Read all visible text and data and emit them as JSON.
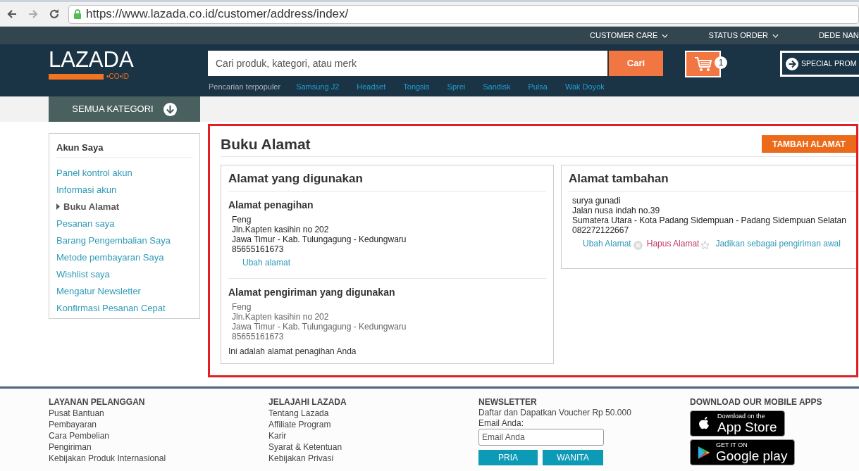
{
  "browser": {
    "url": "https://www.lazada.co.id/customer/address/index/"
  },
  "top_links": [
    {
      "label": "CUSTOMER CARE",
      "dropdown": true
    },
    {
      "label": "STATUS ORDER",
      "dropdown": true
    },
    {
      "label": "DEDE NAN",
      "dropdown": false
    }
  ],
  "logo": {
    "name": "LAZADA",
    "domain": "•CO•ID"
  },
  "search": {
    "placeholder": "Cari produk, kategori, atau merk",
    "button": "Cari"
  },
  "popular": {
    "label": "Pencarian terpopuler",
    "terms": [
      "Samsung J2",
      "Headset",
      "Tongsis",
      "Sprei",
      "Sandisk",
      "Pulsa",
      "Wak Doyok"
    ]
  },
  "cart": {
    "count": "1"
  },
  "promo": {
    "label": "SPECIAL PROM"
  },
  "category_button": "SEMUA KATEGORI",
  "sidebar": {
    "title": "Akun Saya",
    "items": [
      {
        "label": "Panel kontrol akun",
        "selected": false
      },
      {
        "label": "Informasi akun",
        "selected": false
      },
      {
        "label": "Buku Alamat",
        "selected": true
      },
      {
        "label": "Pesanan saya",
        "selected": false
      },
      {
        "label": "Barang Pengembalian Saya",
        "selected": false
      },
      {
        "label": "Metode pembayaran Saya",
        "selected": false
      },
      {
        "label": "Wishlist saya",
        "selected": false
      },
      {
        "label": "Mengatur Newsletter",
        "selected": false
      },
      {
        "label": "Konfirmasi Pesanan Cepat",
        "selected": false
      }
    ]
  },
  "main": {
    "title": "Buku Alamat",
    "add_button": "TAMBAH ALAMAT",
    "used_card": {
      "title": "Alamat yang digunakan",
      "sections": [
        {
          "heading": "Alamat penagihan",
          "muted": false,
          "lines": [
            "Feng",
            "Jln.Kapten kasihin no 202",
            "Jawa Timur - Kab. Tulungagung - Kedungwaru",
            "85655161673"
          ],
          "link": "Ubah alamat"
        },
        {
          "heading": "Alamat pengiriman yang digunakan",
          "muted": true,
          "lines": [
            "Feng",
            "Jln.Kapten kasihin no 202",
            "Jawa Timur - Kab. Tulungagung - Kedungwaru",
            "85655161673"
          ],
          "note": "Ini adalah alamat penagihan Anda"
        }
      ]
    },
    "extra_card": {
      "title": "Alamat tambahan",
      "lines": [
        "surya gunadi",
        "Jalan nusa indah no.39",
        "Sumatera Utara - Kota Padang Sidempuan - Padang Sidempuan Selatan",
        "082272122667"
      ],
      "actions": [
        {
          "label": "Ubah Alamat",
          "kind": "edit"
        },
        {
          "label": "Hapus Alamat",
          "kind": "delete"
        },
        {
          "label": "Jadikan sebagai pengiriman awal",
          "kind": "default"
        }
      ]
    }
  },
  "footer": {
    "columns": [
      {
        "heading": "LAYANAN PELANGGAN",
        "links": [
          "Pusat Bantuan",
          "Pembayaran",
          "Cara Pembelian",
          "Pengiriman",
          "Kebijakan Produk Internasional"
        ]
      },
      {
        "heading": "JELAJAHI LAZADA",
        "links": [
          "Tentang Lazada",
          "Affiliate Program",
          "Karir",
          "Syarat & Ketentuan",
          "Kebijakan Privasi"
        ]
      }
    ],
    "newsletter": {
      "heading": "NEWSLETTER",
      "text": "Daftar dan Dapatkan Voucher Rp 50.000",
      "email_label": "Email Anda:",
      "placeholder": "Email Anda",
      "buttons": [
        "PRIA",
        "WANITA"
      ]
    },
    "apps": {
      "heading": "DOWNLOAD OUR MOBILE APPS",
      "badges": [
        {
          "kind": "apple",
          "small": "Download on the",
          "big": "App Store"
        },
        {
          "kind": "google",
          "small": "GET IT ON",
          "big": "Google play"
        }
      ]
    }
  }
}
